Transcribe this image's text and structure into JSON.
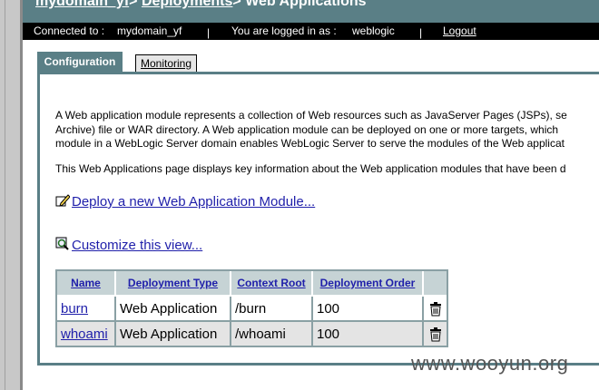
{
  "breadcrumb": {
    "domain": "mydomain_yf",
    "sep1": ">",
    "deployments": "Deployments",
    "sep2": ">",
    "current": "Web Applications"
  },
  "status": {
    "connected_label": "Connected to :",
    "domain": "mydomain_yf",
    "logged_label": "You are logged in as :",
    "user": "weblogic",
    "logout": "Logout"
  },
  "tabs": [
    {
      "label": "Configuration",
      "active": true
    },
    {
      "label": "Monitoring",
      "active": false
    }
  ],
  "intro": [
    "A Web application module represents a collection of Web resources such as JavaServer Pages (JSPs), se",
    "Archive) file or WAR directory. A Web application module can be deployed on one or more targets, which",
    "module in a WebLogic Server domain enables WebLogic Server to serve the modules of the Web applicat",
    "This Web Applications page displays key information about the Web application modules that have been d"
  ],
  "actions": {
    "deploy": "Deploy a new Web Application Module...",
    "customize": "Customize this view..."
  },
  "table": {
    "headers": [
      "Name",
      "Deployment Type",
      "Context Root",
      "Deployment Order"
    ],
    "rows": [
      {
        "name": "burn",
        "type": "Web Application",
        "context": "/burn",
        "order": "100"
      },
      {
        "name": "whoami",
        "type": "Web Application",
        "context": "/whoami",
        "order": "100"
      }
    ]
  },
  "watermark": "www.wooyun.org",
  "colors": {
    "banner": "#5a7f86",
    "link": "#1f1faa",
    "header_bg": "#c6d3d5"
  }
}
